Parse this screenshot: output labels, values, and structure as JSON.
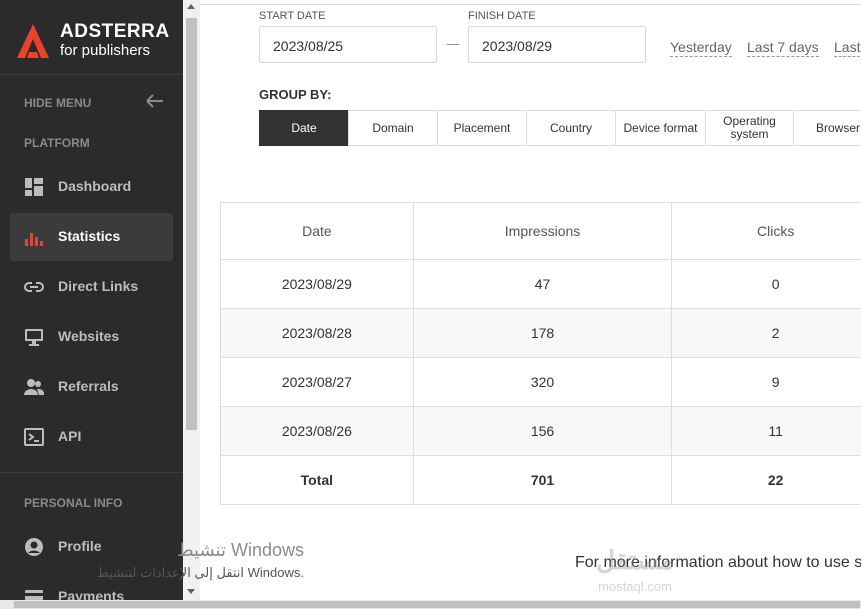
{
  "sidebar": {
    "brand": "ADSTERRA",
    "brand_sub": "for publishers",
    "hide_menu": "HIDE MENU",
    "platform_label": "PLATFORM",
    "items": [
      {
        "label": "Dashboard",
        "icon": "dashboard-icon"
      },
      {
        "label": "Statistics",
        "icon": "bar-chart-icon"
      },
      {
        "label": "Direct Links",
        "icon": "link-icon"
      },
      {
        "label": "Websites",
        "icon": "monitor-icon"
      },
      {
        "label": "Referrals",
        "icon": "people-icon"
      },
      {
        "label": "API",
        "icon": "terminal-icon"
      }
    ],
    "personal_label": "PERSONAL INFO",
    "personal_items": [
      {
        "label": "Profile",
        "icon": "user-circle-icon"
      },
      {
        "label": "Payments",
        "icon": "card-icon"
      }
    ],
    "active_item": "Statistics"
  },
  "filters": {
    "start_label": "START DATE",
    "start_value": "2023/08/25",
    "finish_label": "FINISH DATE",
    "finish_value": "2023/08/29",
    "quick": [
      "Yesterday",
      "Last 7 days",
      "Last"
    ],
    "groupby_label": "GROUP BY:",
    "groupby_tabs": [
      "Date",
      "Domain",
      "Placement",
      "Country",
      "Device format",
      "Operating system",
      "Browser"
    ],
    "groupby_active": "Date"
  },
  "table": {
    "headers": [
      "Date",
      "Impressions",
      "Clicks"
    ],
    "rows": [
      [
        "2023/08/29",
        "47",
        "0"
      ],
      [
        "2023/08/28",
        "178",
        "2"
      ],
      [
        "2023/08/27",
        "320",
        "9"
      ],
      [
        "2023/08/26",
        "156",
        "11"
      ]
    ],
    "total": [
      "Total",
      "701",
      "22"
    ]
  },
  "info_text": "For more information about how to use s",
  "overlay": {
    "windows_line1": "تنشيط Windows",
    "windows_line2": "انتقل إلى الإعدادات لتنشيط Windows.",
    "mostaql_ar": "مستقل",
    "mostaql_en": "mostaql.com"
  },
  "colors": {
    "brand_orange": "#e8442a",
    "sidebar_bg": "#2b2b2b",
    "active_tab": "#333333"
  }
}
